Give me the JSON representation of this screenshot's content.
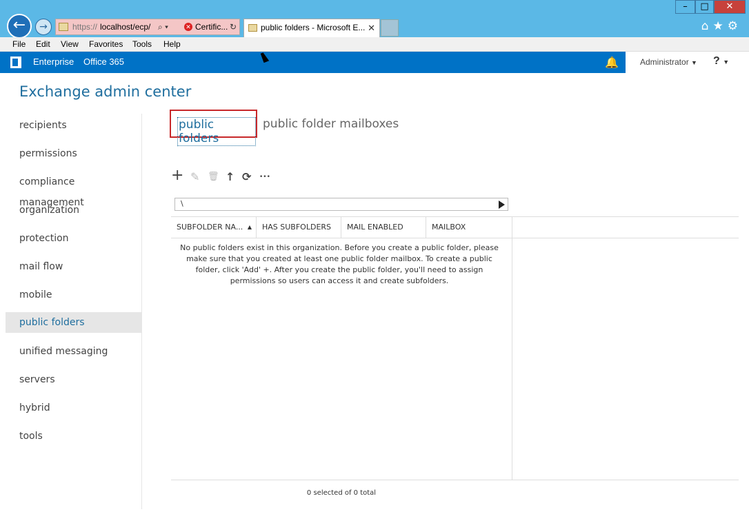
{
  "browser": {
    "address": {
      "protocol": "https://",
      "host": "localhost/ecp/",
      "search_glyph": "⌕ ▾",
      "cert_label": "Certific..."
    },
    "tab": {
      "title": "public folders - Microsoft E...",
      "close_glyph": "✕"
    },
    "window_controls": {
      "minimize": "–",
      "maximize": "□",
      "close": "✕"
    },
    "toolbar_icons": "⌂★⚙"
  },
  "menubar": {
    "items": [
      "File",
      "Edit",
      "View",
      "Favorites",
      "Tools",
      "Help"
    ]
  },
  "o365bar": {
    "enterprise": "Enterprise",
    "office365": "Office 365",
    "user": "Administrator",
    "help": "?"
  },
  "app": {
    "title": "Exchange admin center"
  },
  "leftnav": {
    "items": [
      "recipients",
      "permissions",
      "compliance management",
      "organization",
      "protection",
      "mail flow",
      "mobile",
      "public folders",
      "unified messaging",
      "servers",
      "hybrid",
      "tools"
    ],
    "active": "public folders"
  },
  "subtabs": {
    "public_folders": "public folders",
    "public_folder_mailboxes": "public folder mailboxes"
  },
  "toolbar": {
    "add": "+",
    "edit": "✎",
    "delete": "🗑",
    "up": "↑",
    "refresh": "⟳",
    "more": "•••"
  },
  "pathbar": {
    "value": "\\"
  },
  "table": {
    "columns": [
      "SUBFOLDER NA...",
      "HAS SUBFOLDERS",
      "MAIL ENABLED",
      "MAILBOX"
    ],
    "empty_message": "No public folders exist in this organization. Before you create a public folder, please make sure that you created at least one public folder mailbox. To create a public folder, click 'Add' +. After you create the public folder, you'll need to assign permissions so users can access it and create subfolders.",
    "status": "0 selected of 0 total"
  }
}
